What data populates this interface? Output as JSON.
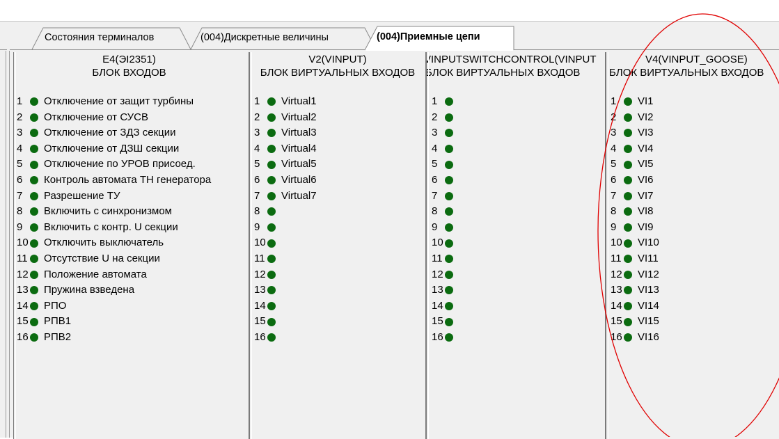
{
  "tabs": [
    {
      "label": "Состояния терминалов",
      "active": false
    },
    {
      "label": "(004)Дискретные величины",
      "active": false
    },
    {
      "label": "(004)Приемные цепи",
      "active": true
    }
  ],
  "colors": {
    "led_on": "#0b6b10",
    "annotation": "#e00000"
  },
  "panels": [
    {
      "title": "E4(ЭI2351)",
      "subtitle": "БЛОК ВХОДОВ",
      "items": [
        {
          "num": "1",
          "label": "Отключение от защит турбины"
        },
        {
          "num": "2",
          "label": "Отключение от СУСВ"
        },
        {
          "num": "3",
          "label": "Отключение от ЗДЗ секции"
        },
        {
          "num": "4",
          "label": "Отключение от ДЗШ секции"
        },
        {
          "num": "5",
          "label": "Отключение по УРОВ присоед."
        },
        {
          "num": "6",
          "label": "Контроль автомата ТН генератора"
        },
        {
          "num": "7",
          "label": "Разрешение ТУ"
        },
        {
          "num": "8",
          "label": "Включить с синхронизмом"
        },
        {
          "num": "9",
          "label": "Включить с контр. U секции"
        },
        {
          "num": "10",
          "label": "Отключить выключатель"
        },
        {
          "num": "11",
          "label": "Отсутствие U на секции"
        },
        {
          "num": "12",
          "label": "Положение автомата"
        },
        {
          "num": "13",
          "label": "Пружина взведена"
        },
        {
          "num": "14",
          "label": "РПО"
        },
        {
          "num": "15",
          "label": "РПВ1"
        },
        {
          "num": "16",
          "label": "РПВ2"
        }
      ]
    },
    {
      "title": "V2(VINPUT)",
      "subtitle": "БЛОК ВИРТУАЛЬНЫХ ВХОДОВ",
      "items": [
        {
          "num": "1",
          "label": "Virtual1"
        },
        {
          "num": "2",
          "label": "Virtual2"
        },
        {
          "num": "3",
          "label": "Virtual3"
        },
        {
          "num": "4",
          "label": "Virtual4"
        },
        {
          "num": "5",
          "label": "Virtual5"
        },
        {
          "num": "6",
          "label": "Virtual6"
        },
        {
          "num": "7",
          "label": "Virtual7"
        },
        {
          "num": "8",
          "label": ""
        },
        {
          "num": "9",
          "label": ""
        },
        {
          "num": "10",
          "label": ""
        },
        {
          "num": "11",
          "label": ""
        },
        {
          "num": "12",
          "label": ""
        },
        {
          "num": "13",
          "label": ""
        },
        {
          "num": "14",
          "label": ""
        },
        {
          "num": "15",
          "label": ""
        },
        {
          "num": "16",
          "label": ""
        }
      ]
    },
    {
      "title": "VINPUTSWITCHCONTROL(VINPUT",
      "subtitle": "БЛОК ВИРТУАЛЬНЫХ ВХОДОВ",
      "items": [
        {
          "num": "1",
          "label": ""
        },
        {
          "num": "2",
          "label": ""
        },
        {
          "num": "3",
          "label": ""
        },
        {
          "num": "4",
          "label": ""
        },
        {
          "num": "5",
          "label": ""
        },
        {
          "num": "6",
          "label": ""
        },
        {
          "num": "7",
          "label": ""
        },
        {
          "num": "8",
          "label": ""
        },
        {
          "num": "9",
          "label": ""
        },
        {
          "num": "10",
          "label": ""
        },
        {
          "num": "11",
          "label": ""
        },
        {
          "num": "12",
          "label": ""
        },
        {
          "num": "13",
          "label": ""
        },
        {
          "num": "14",
          "label": ""
        },
        {
          "num": "15",
          "label": ""
        },
        {
          "num": "16",
          "label": ""
        }
      ]
    },
    {
      "title": "V4(VINPUT_GOOSE)",
      "subtitle": "БЛОК ВИРТУАЛЬНЫХ ВХОДОВ",
      "items": [
        {
          "num": "1",
          "label": "VI1"
        },
        {
          "num": "2",
          "label": "VI2"
        },
        {
          "num": "3",
          "label": "VI3"
        },
        {
          "num": "4",
          "label": "VI4"
        },
        {
          "num": "5",
          "label": "VI5"
        },
        {
          "num": "6",
          "label": "VI6"
        },
        {
          "num": "7",
          "label": "VI7"
        },
        {
          "num": "8",
          "label": "VI8"
        },
        {
          "num": "9",
          "label": "VI9"
        },
        {
          "num": "10",
          "label": "VI10"
        },
        {
          "num": "11",
          "label": "VI11"
        },
        {
          "num": "12",
          "label": "VI12"
        },
        {
          "num": "13",
          "label": "VI13"
        },
        {
          "num": "14",
          "label": "VI14"
        },
        {
          "num": "15",
          "label": "VI15"
        },
        {
          "num": "16",
          "label": "VI16"
        }
      ]
    }
  ]
}
